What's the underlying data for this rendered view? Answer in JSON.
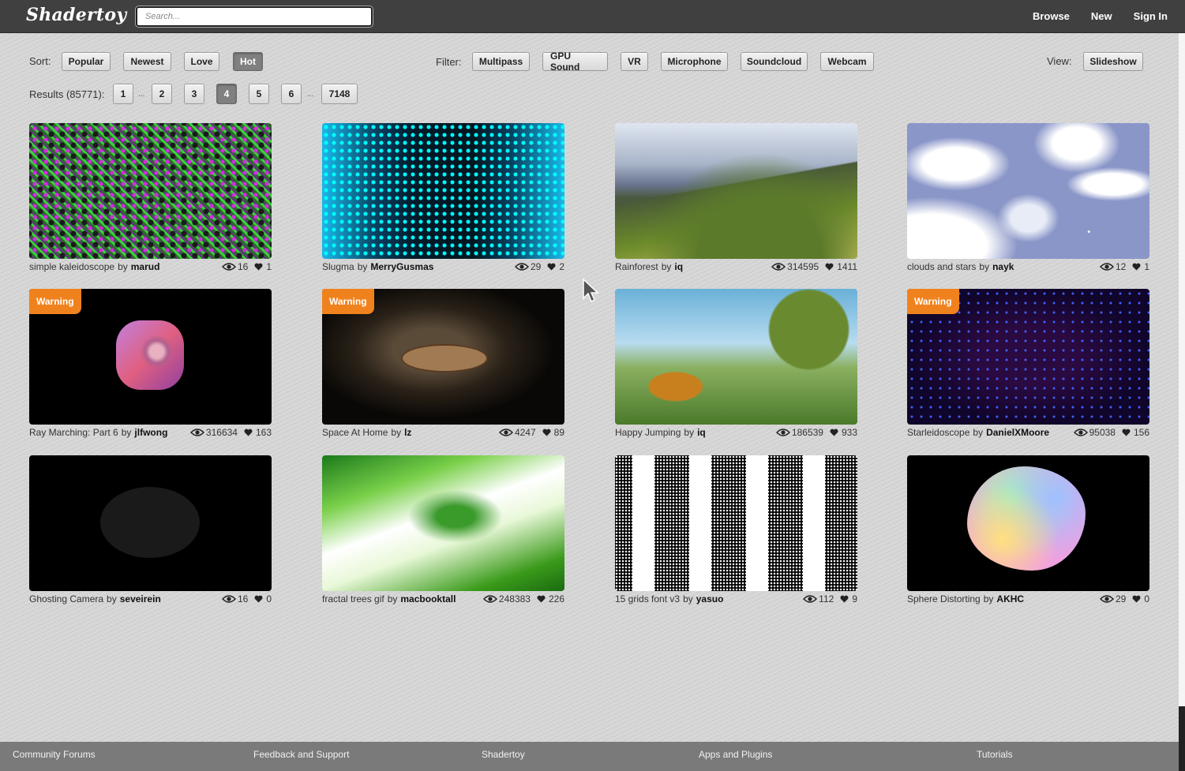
{
  "header": {
    "logo": "Shadertoy",
    "search_placeholder": "Search...",
    "nav": [
      "Browse",
      "New",
      "Sign In"
    ]
  },
  "controls": {
    "sort_label": "Sort:",
    "sort_options": [
      "Popular",
      "Newest",
      "Love",
      "Hot"
    ],
    "sort_active": "Hot",
    "filter_label": "Filter:",
    "filters": [
      "Multipass",
      "GPU Sound",
      "VR",
      "Microphone",
      "Soundcloud",
      "Webcam"
    ],
    "view_label": "View:",
    "view_option": "Slideshow",
    "results_label": "Results (85771):",
    "pages": [
      "1",
      "2",
      "3",
      "4",
      "5",
      "6",
      "7148"
    ],
    "page_active": "4",
    "ellipsis": "..."
  },
  "by_word": "by",
  "warning_label": "Warning",
  "shaders": [
    {
      "title": "simple kaleidoscope",
      "author": "marud",
      "views": "16",
      "likes": "1",
      "warning": false
    },
    {
      "title": "Slugma",
      "author": "MerryGusmas",
      "views": "29",
      "likes": "2",
      "warning": false
    },
    {
      "title": "Rainforest",
      "author": "iq",
      "views": "314595",
      "likes": "1411",
      "warning": false
    },
    {
      "title": "clouds and stars",
      "author": "nayk",
      "views": "12",
      "likes": "1",
      "warning": false
    },
    {
      "title": "Ray Marching: Part 6",
      "author": "jlfwong",
      "views": "316634",
      "likes": "163",
      "warning": true
    },
    {
      "title": "Space At Home",
      "author": "lz",
      "views": "4247",
      "likes": "89",
      "warning": true
    },
    {
      "title": "Happy Jumping",
      "author": "iq",
      "views": "186539",
      "likes": "933",
      "warning": false
    },
    {
      "title": "Starleidoscope",
      "author": "DanielXMoore",
      "views": "95038",
      "likes": "156",
      "warning": true
    },
    {
      "title": "Ghosting Camera",
      "author": "seveirein",
      "views": "16",
      "likes": "0",
      "warning": false
    },
    {
      "title": "fractal trees gif",
      "author": "macbooktall",
      "views": "248383",
      "likes": "226",
      "warning": false
    },
    {
      "title": "15 grids font v3",
      "author": "yasuo",
      "views": "112",
      "likes": "9",
      "warning": false
    },
    {
      "title": "Sphere Distorting",
      "author": "AKHC",
      "views": "29",
      "likes": "0",
      "warning": false
    }
  ],
  "footer": {
    "links": [
      "Community Forums",
      "Feedback and Support",
      "Shadertoy",
      "Apps and Plugins",
      "Tutorials"
    ]
  }
}
